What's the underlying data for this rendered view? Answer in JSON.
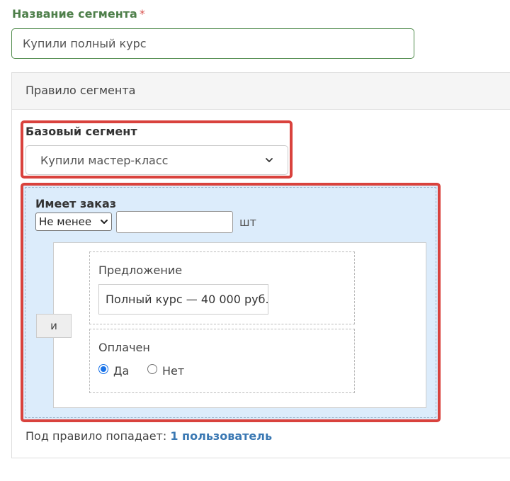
{
  "segment_name": {
    "label": "Название сегмента",
    "required_mark": "*",
    "value": "Купили полный курс"
  },
  "rule": {
    "header": "Правило сегмента",
    "base_segment": {
      "label": "Базовый сегмент",
      "selected": "Купили мастер-класс"
    },
    "order_condition": {
      "label": "Имеет заказ",
      "comparator": "Не менее",
      "count_value": "",
      "unit": "шт",
      "logic_operator": "и",
      "offer": {
        "label": "Предложение",
        "value": "Полный курс — 40 000 руб."
      },
      "paid": {
        "label": "Оплачен",
        "options": [
          {
            "label": "Да",
            "checked": true
          },
          {
            "label": "Нет",
            "checked": false
          }
        ]
      }
    },
    "footer": {
      "prefix": "Под правило попадает: ",
      "link": "1 пользователь"
    }
  },
  "colors": {
    "accent_green": "#4e7f4a",
    "highlight_red": "#d9423d",
    "condition_bg": "#dcecfb",
    "link_blue": "#3a78b3"
  }
}
